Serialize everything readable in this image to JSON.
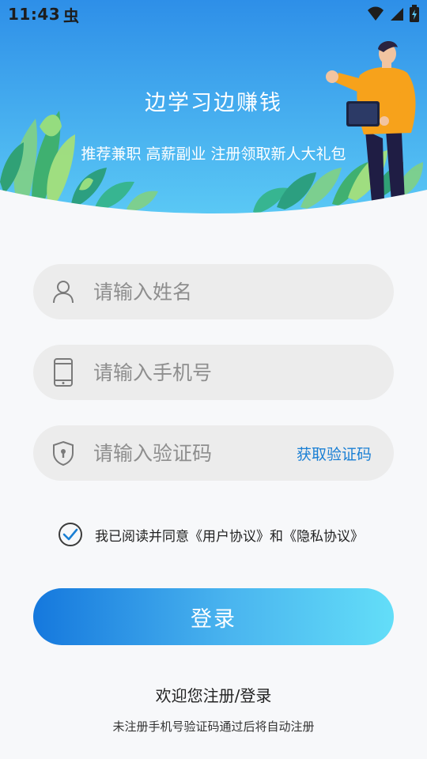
{
  "status_bar": {
    "time": "11:43",
    "app_glyph": "虫",
    "icons": [
      "wifi-icon",
      "signal-icon",
      "battery-charging-icon"
    ]
  },
  "hero": {
    "title": "边学习边赚钱",
    "subtitle": "推荐兼职 高薪副业 注册领取新人大礼包",
    "colors": {
      "gradient_top": "#2e8fe8",
      "gradient_bottom": "#5bc9f5"
    }
  },
  "form": {
    "name_field": {
      "placeholder": "请输入姓名",
      "value": "",
      "icon": "user-icon"
    },
    "phone_field": {
      "placeholder": "请输入手机号",
      "value": "",
      "icon": "phone-icon"
    },
    "code_field": {
      "placeholder": "请输入验证码",
      "value": "",
      "icon": "shield-icon",
      "action_label": "获取验证码"
    }
  },
  "agreement": {
    "checked": true,
    "text": "我已阅读并同意《用户协议》和《隐私协议》"
  },
  "login_button": {
    "label": "登录"
  },
  "footer": {
    "welcome": "欢迎您注册/登录",
    "note": "未注册手机号验证码通过后将自动注册"
  },
  "colors": {
    "accent": "#1a7fd4",
    "button_gradient_start": "#1578dd",
    "button_gradient_end": "#63def8",
    "field_background": "#ececec"
  }
}
